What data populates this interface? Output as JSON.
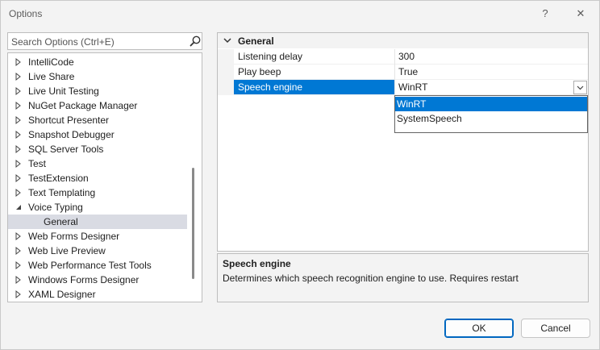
{
  "window": {
    "title": "Options",
    "help_glyph": "?",
    "close_glyph": "✕"
  },
  "search": {
    "placeholder": "Search Options (Ctrl+E)"
  },
  "tree": {
    "items": [
      {
        "label": "IntelliCode",
        "state": "collapsed"
      },
      {
        "label": "Live Share",
        "state": "collapsed"
      },
      {
        "label": "Live Unit Testing",
        "state": "collapsed"
      },
      {
        "label": "NuGet Package Manager",
        "state": "collapsed"
      },
      {
        "label": "Shortcut Presenter",
        "state": "collapsed"
      },
      {
        "label": "Snapshot Debugger",
        "state": "collapsed"
      },
      {
        "label": "SQL Server Tools",
        "state": "collapsed"
      },
      {
        "label": "Test",
        "state": "collapsed"
      },
      {
        "label": "TestExtension",
        "state": "collapsed"
      },
      {
        "label": "Text Templating",
        "state": "collapsed"
      },
      {
        "label": "Voice Typing",
        "state": "expanded"
      },
      {
        "label": "General",
        "state": "child-selected"
      },
      {
        "label": "Web Forms Designer",
        "state": "collapsed"
      },
      {
        "label": "Web Live Preview",
        "state": "collapsed"
      },
      {
        "label": "Web Performance Test Tools",
        "state": "collapsed"
      },
      {
        "label": "Windows Forms Designer",
        "state": "collapsed"
      },
      {
        "label": "XAML Designer",
        "state": "collapsed"
      }
    ]
  },
  "grid": {
    "category": "General",
    "properties": [
      {
        "name": "Listening delay",
        "value": "300"
      },
      {
        "name": "Play beep",
        "value": "True"
      },
      {
        "name": "Speech engine",
        "value": "WinRT",
        "selected": true
      }
    ]
  },
  "dropdown": {
    "options": [
      "WinRT",
      "SystemSpeech"
    ],
    "highlighted": "WinRT"
  },
  "description": {
    "title": "Speech engine",
    "text": "Determines which speech recognition engine to use. Requires restart"
  },
  "buttons": {
    "ok": "OK",
    "cancel": "Cancel"
  },
  "colors": {
    "accent": "#0078d4",
    "selected_tree_bg": "#d9dbe3"
  }
}
